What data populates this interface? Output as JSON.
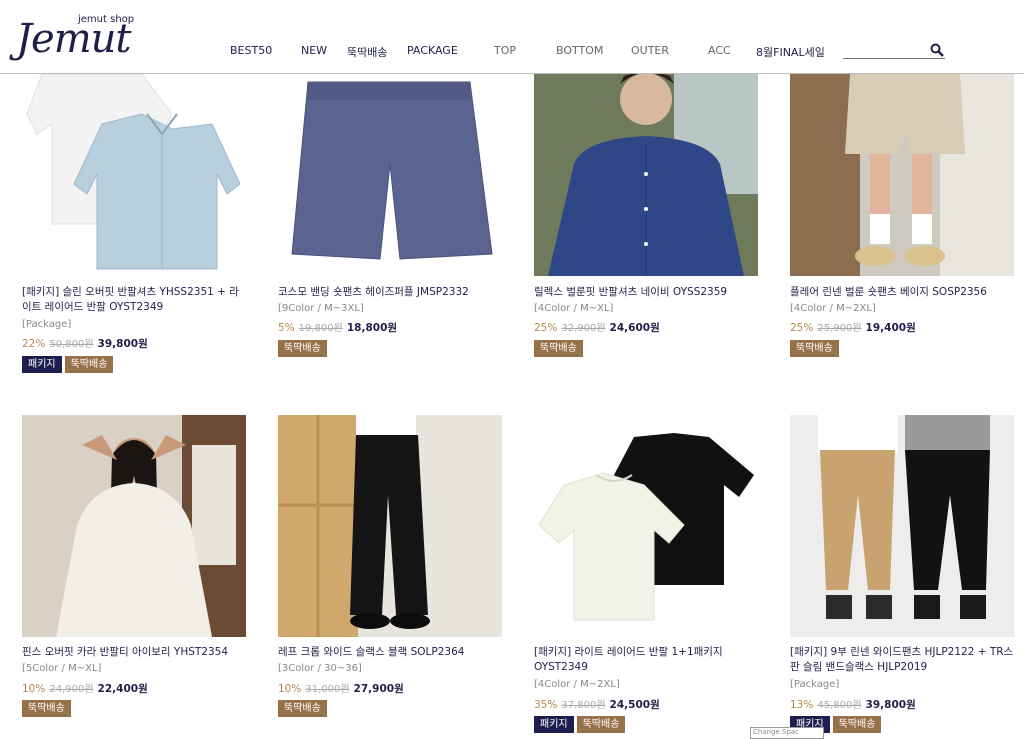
{
  "header": {
    "logo_sub": "jemut shop",
    "logo_main": "Jemut",
    "nav": [
      {
        "label": "BEST50"
      },
      {
        "label": "NEW"
      },
      {
        "label": "뚝딱배송"
      },
      {
        "label": "PACKAGE"
      },
      {
        "label": "TOP"
      },
      {
        "label": "BOTTOM"
      },
      {
        "label": "OUTER"
      },
      {
        "label": "ACC"
      },
      {
        "label": "8월FINAL세일"
      }
    ],
    "search_value": ""
  },
  "products": [
    {
      "name": "[패키지] 슬린 오버핏 반팔셔츠 YHSS2351 + 라이트 레이어드 반팔 OYST2349",
      "option": "[Package]",
      "discount": "22%",
      "original": "50,800원",
      "sale": "39,800원",
      "badges": [
        "패키지",
        "뚝딱배송"
      ]
    },
    {
      "name": "코스모 밴딩 숏팬츠 헤이즈퍼플 JMSP2332",
      "option": "[9Color / M~3XL]",
      "discount": "5%",
      "original": "19,800원",
      "sale": "18,800원",
      "badges": [
        "뚝딱배송"
      ]
    },
    {
      "name": "릴렉스 벌룬핏 반팔셔츠 네이비 OYSS2359",
      "option": "[4Color / M~XL]",
      "discount": "25%",
      "original": "32,900원",
      "sale": "24,600원",
      "badges": [
        "뚝딱배송"
      ]
    },
    {
      "name": "플레어 린넨 벌룬 숏팬츠 베이지 SOSP2356",
      "option": "[4Color / M~2XL]",
      "discount": "25%",
      "original": "25,900원",
      "sale": "19,400원",
      "badges": [
        "뚝딱배송"
      ]
    },
    {
      "name": "핀스 오버핏 카라 반팔티 아이보리 YHST2354",
      "option": "[5Color / M~XL]",
      "discount": "10%",
      "original": "24,900원",
      "sale": "22,400원",
      "badges": [
        "뚝딱배송"
      ]
    },
    {
      "name": "레프 크롭 와이드 슬랙스 블랙 SOLP2364",
      "option": "[3Color / 30~36]",
      "discount": "10%",
      "original": "31,000원",
      "sale": "27,900원",
      "badges": [
        "뚝딱배송"
      ]
    },
    {
      "name": "[패키지] 라이트 레이어드 반팔 1+1패키지 OYST2349",
      "option": "[4Color / M~2XL]",
      "discount": "35%",
      "original": "37,800원",
      "sale": "24,500원",
      "badges": [
        "패키지",
        "뚝딱배송"
      ]
    },
    {
      "name": "[패키지] 9부 린넨 와이드팬츠 HJLP2122 + TR스판 슬림 밴드슬랙스 HJLP2019",
      "option": "[Package]",
      "discount": "13%",
      "original": "45,800원",
      "sale": "39,800원",
      "badges": [
        "패키지",
        "뚝딱배송"
      ]
    }
  ],
  "tooltip": "Change Spac",
  "colors": {
    "navy": "#1d1e4f",
    "brown": "#987049",
    "discount": "#b58b4a"
  }
}
